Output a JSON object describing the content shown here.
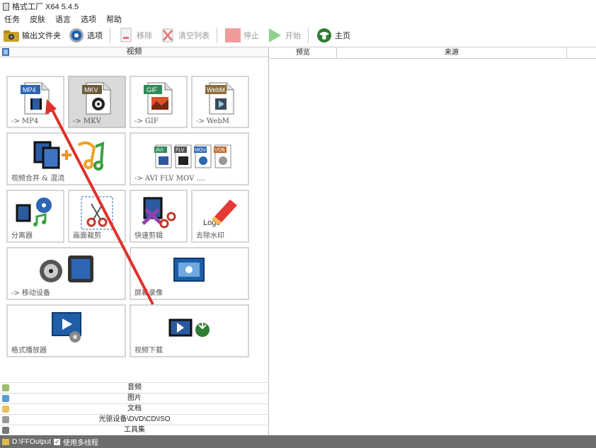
{
  "window": {
    "title": "格式工厂 X64 5.4.5"
  },
  "menu": [
    "任务",
    "皮肤",
    "语言",
    "选项",
    "帮助"
  ],
  "toolbar": {
    "output_folder": "输出文件夹",
    "options": "选项",
    "remove": "移除",
    "clear_list": "清空列表",
    "stop": "停止",
    "start": "开始",
    "home": "主页"
  },
  "video_section": {
    "title": "视频"
  },
  "tiles": {
    "mp4": {
      "badge": "MP4",
      "caption": "-> MP4"
    },
    "mkv": {
      "badge": "MKV",
      "caption": "-> MKV"
    },
    "gif": {
      "badge": "GIF",
      "caption": "-> GIF"
    },
    "webm": {
      "badge": "WebM",
      "caption": "-> WebM"
    },
    "merge": {
      "caption": "视频合并 & 混流"
    },
    "multi": {
      "badges": [
        "AVI",
        "FLV",
        "MOV",
        "VOB"
      ],
      "caption": "-> AVI FLV MOV ...."
    },
    "splitter": {
      "caption": "分离器"
    },
    "crop": {
      "caption": "画面裁剪"
    },
    "quickcut": {
      "caption": "快速剪辑"
    },
    "watermark": {
      "caption": "去除水印",
      "logo_text": "Logo"
    },
    "mobile": {
      "caption": "-> 移动设备"
    },
    "screenrec": {
      "caption": "屏幕录像"
    },
    "player": {
      "caption": "格式播放器"
    },
    "download": {
      "caption": "视频下载"
    }
  },
  "bottom_sections": [
    "音频",
    "图片",
    "文档",
    "光驱设备\\DVD\\CD\\ISO",
    "工具集"
  ],
  "task_table": {
    "columns": [
      "预览",
      "来源"
    ]
  },
  "status": {
    "output_path": "D:\\FFOutput",
    "multithread_label": "使用多线程",
    "multithread_checked": true
  },
  "colors": {
    "accent_red": "#e0312b",
    "status_bg": "#6d6d6d"
  }
}
